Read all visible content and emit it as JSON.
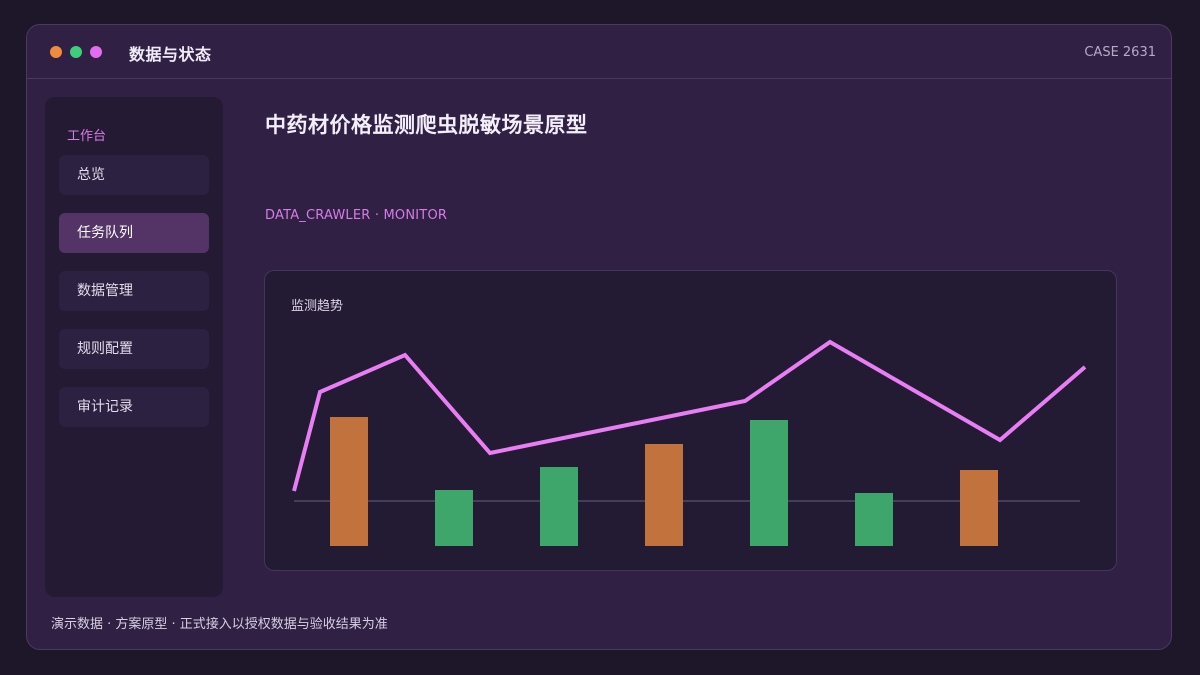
{
  "window": {
    "app_title": "数据与状态",
    "case_id": "CASE 2631"
  },
  "sidebar": {
    "header": "工作台",
    "items": [
      {
        "label": "总览",
        "active": false
      },
      {
        "label": "任务队列",
        "active": true
      },
      {
        "label": "数据管理",
        "active": false
      },
      {
        "label": "规则配置",
        "active": false
      },
      {
        "label": "审计记录",
        "active": false
      }
    ]
  },
  "main": {
    "title": "中药材价格监测爬虫脱敏场景原型",
    "subtitle": "DATA_CRAWLER · MONITOR"
  },
  "chart_card": {
    "title": "监测趋势"
  },
  "footer": {
    "note": "演示数据 · 方案原型 · 正式接入以授权数据与验收结果为准"
  },
  "colors": {
    "accent": "#d77ce6",
    "line": "#e97ef4",
    "bar_orange": "#c2723c",
    "bar_green": "#3fa66b",
    "baseline": "#55486a"
  },
  "chart_data": {
    "type": "bar",
    "title": "监测趋势",
    "xlabel": "",
    "ylabel": "",
    "bars": [
      {
        "value": 84,
        "color": "orange"
      },
      {
        "value": 11,
        "color": "green"
      },
      {
        "value": 34,
        "color": "green"
      },
      {
        "value": 57,
        "color": "orange"
      },
      {
        "value": 81,
        "color": "green"
      },
      {
        "value": 8,
        "color": "green"
      },
      {
        "value": 31,
        "color": "orange"
      }
    ],
    "line": [
      10,
      109,
      146,
      48,
      100,
      159,
      61,
      134
    ],
    "ylim": [
      -45,
      170
    ],
    "grid": false,
    "legend": "none"
  }
}
